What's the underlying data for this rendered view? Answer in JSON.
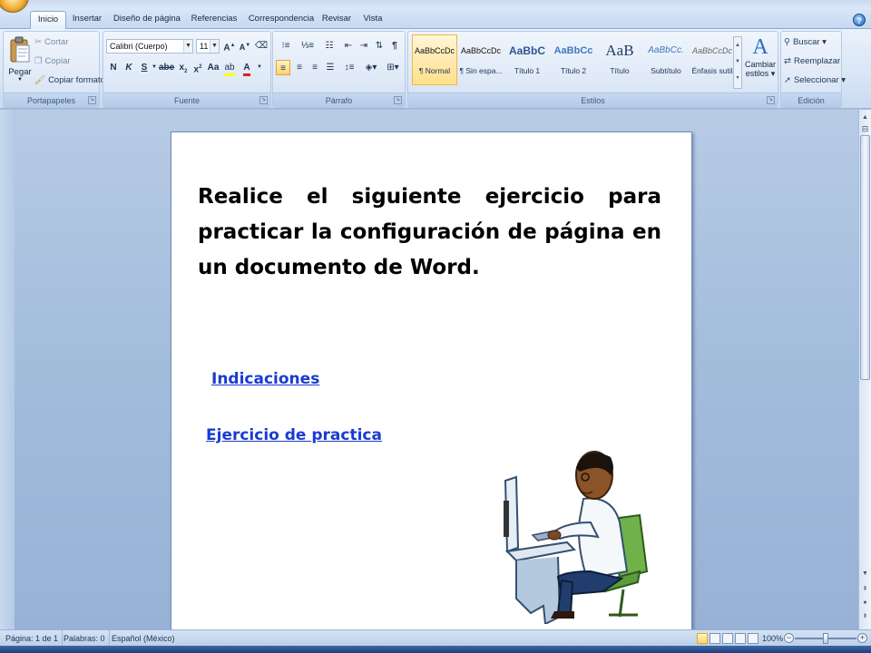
{
  "tabs": [
    "Inicio",
    "Insertar",
    "Diseño de página",
    "Referencias",
    "Correspondencia",
    "Revisar",
    "Vista"
  ],
  "clipboard": {
    "paste_label": "Pegar",
    "cut_label": "Cortar",
    "copy_label": "Copiar",
    "format_painter_label": "Copiar formato",
    "group_label": "Portapapeles"
  },
  "font": {
    "font_name": "Calibri (Cuerpo)",
    "font_size": "11",
    "bold": "N",
    "italic": "K",
    "underline": "S",
    "group_label": "Fuente"
  },
  "paragraph": {
    "group_label": "Párrafo"
  },
  "styles": {
    "items": [
      {
        "sample": "AaBbCcDc",
        "name": "¶ Normal"
      },
      {
        "sample": "AaBbCcDc",
        "name": "¶ Sin espa..."
      },
      {
        "sample": "AaBbC",
        "name": "Título 1"
      },
      {
        "sample": "AaBbCc",
        "name": "Título 2"
      },
      {
        "sample": "AaB",
        "name": "Título"
      },
      {
        "sample": "AaBbCc.",
        "name": "Subtítulo"
      },
      {
        "sample": "AaBbCcDc",
        "name": "Énfasis sutil"
      }
    ],
    "change_styles_label_1": "Cambiar",
    "change_styles_label_2": "estilos",
    "group_label": "Estilos"
  },
  "editing": {
    "find_label": "Buscar",
    "replace_label": "Reemplazar",
    "select_label": "Seleccionar",
    "group_label": "Edición"
  },
  "document": {
    "paragraph": "Realice el siguiente ejercicio para practicar la configuración de página en un documento de Word.",
    "link_1": "Indicaciones",
    "link_2": "Ejercicio de practica"
  },
  "status": {
    "page": "Página: 1 de 1",
    "words": "Palabras: 0",
    "language": "Español (México)",
    "zoom": "100%",
    "zoom_level_percent": 100
  },
  "colors": {
    "accent_link": "#1a3bd1",
    "highlight": "#ffff00",
    "font_color": "#e02020"
  }
}
